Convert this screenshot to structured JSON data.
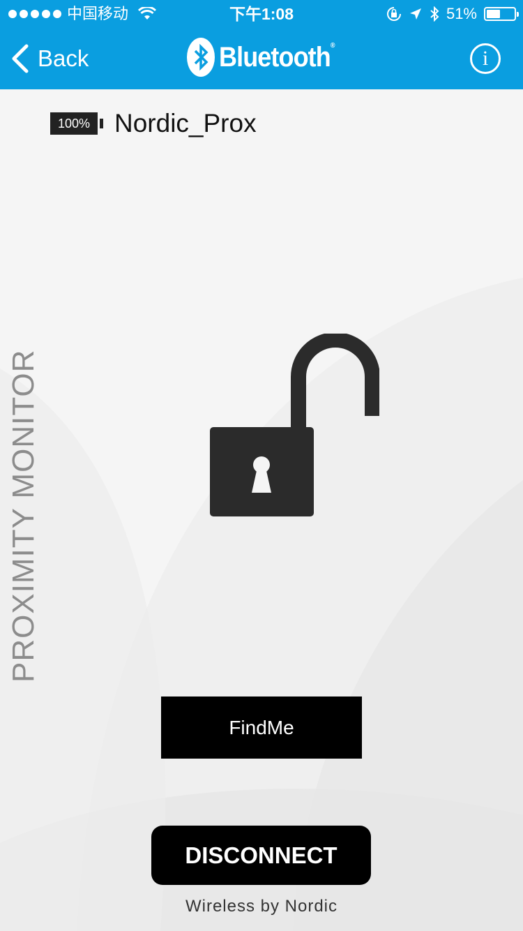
{
  "status_bar": {
    "carrier": "中国移动",
    "time": "下午1:08",
    "battery_percent_label": "51%",
    "battery_level": 0.51
  },
  "nav": {
    "back_label": "Back",
    "logo_text": "Bluetooth",
    "logo_reg": "®",
    "info_label": "i"
  },
  "device": {
    "battery_label": "100%",
    "name": "Nordic_Prox"
  },
  "side_title": "PROXIMITY MONITOR",
  "lock_state": "unlocked",
  "buttons": {
    "findme": "FindMe",
    "disconnect": "DISCONNECT"
  },
  "footer": "Wireless by Nordic",
  "colors": {
    "accent": "#0a9ee0",
    "dark": "#2b2b2b",
    "side_title": "#8c8c8c"
  },
  "icons": [
    "signal-icon",
    "wifi-icon",
    "orientation-lock-icon",
    "location-icon",
    "bluetooth-status-icon",
    "battery-icon",
    "back-chevron-icon",
    "bluetooth-logo-icon",
    "info-icon",
    "padlock-open-icon"
  ]
}
